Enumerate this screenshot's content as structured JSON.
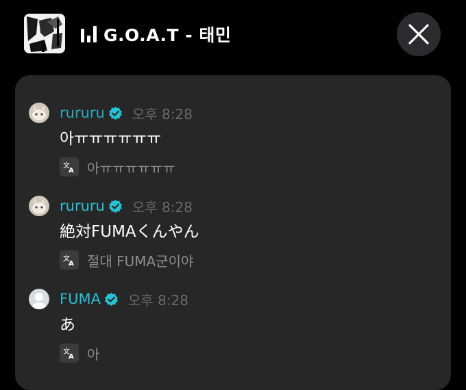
{
  "header": {
    "track_title": "G.O.A.T - 태민",
    "playing_icon": "equalizer-icon",
    "close_icon": "close-icon"
  },
  "colors": {
    "background": "#000000",
    "panel": "#272727",
    "username": "#2fb4c6",
    "username_bright": "#27c2d6",
    "verified_badge": "#27c2d6",
    "time": "#6b6b6b",
    "translation_text": "#8e8e8e"
  },
  "messages": [
    {
      "username": "rururu",
      "verified": true,
      "time": "오후 8:28",
      "text": "아ㅠㅠㅠㅠㅠㅠ",
      "translation": "아ㅠㅠㅠㅠㅠㅠ",
      "avatar": "cat-avatar"
    },
    {
      "username": "rururu",
      "verified": true,
      "time": "오후 8:28",
      "text": "絶対FUMAくんやん",
      "translation": "절대 FUMA군이야",
      "avatar": "cat-avatar"
    },
    {
      "username": "FUMA",
      "verified": true,
      "time": "오후 8:28",
      "text": "あ",
      "translation": "아",
      "avatar": "default-avatar"
    }
  ]
}
